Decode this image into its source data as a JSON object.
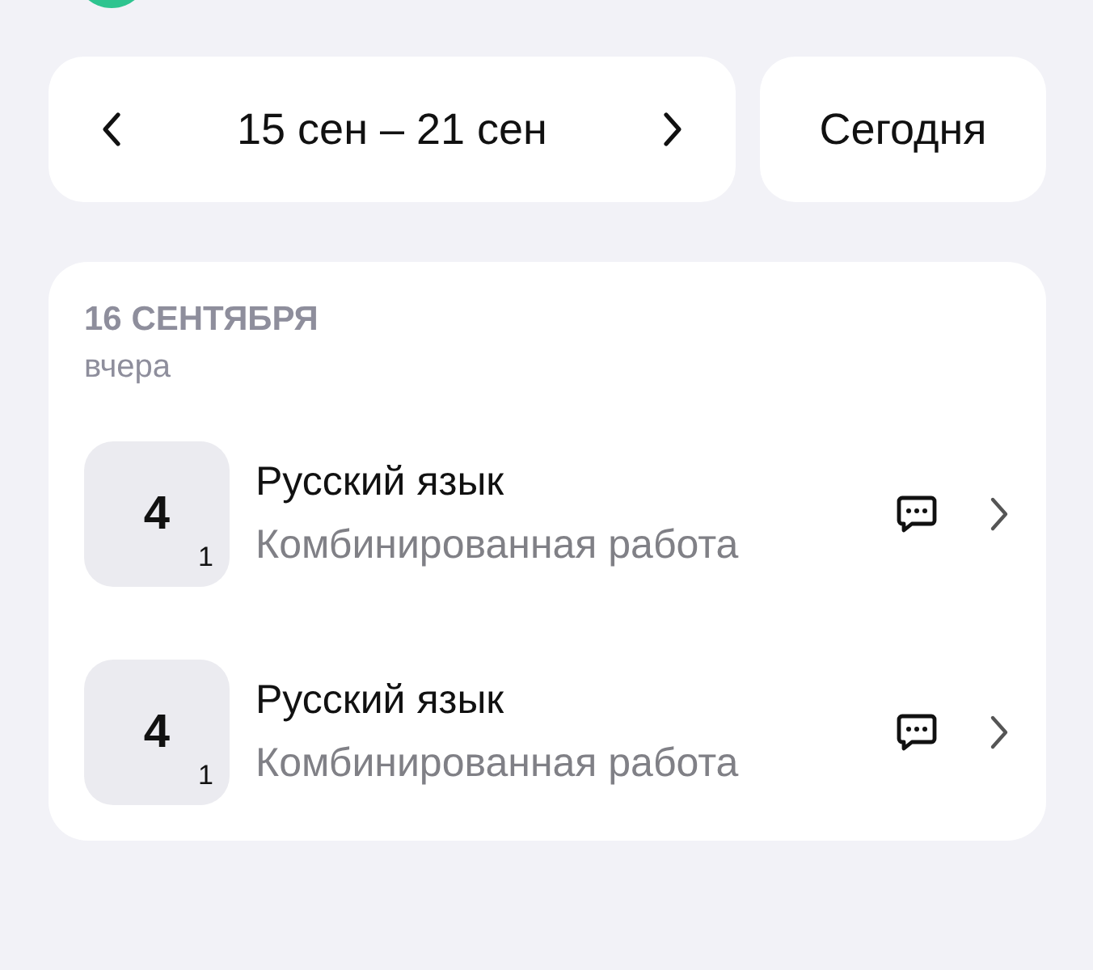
{
  "week_nav": {
    "range": "15 сен – 21 сен"
  },
  "today_button": "Сегодня",
  "day": {
    "date": "16 СЕНТЯБРЯ",
    "relative": "вчера",
    "marks": [
      {
        "grade": "4",
        "weight": "1",
        "subject": "Русский язык",
        "work": "Комбинированная работа"
      },
      {
        "grade": "4",
        "weight": "1",
        "subject": "Русский язык",
        "work": "Комбинированная работа"
      }
    ]
  }
}
